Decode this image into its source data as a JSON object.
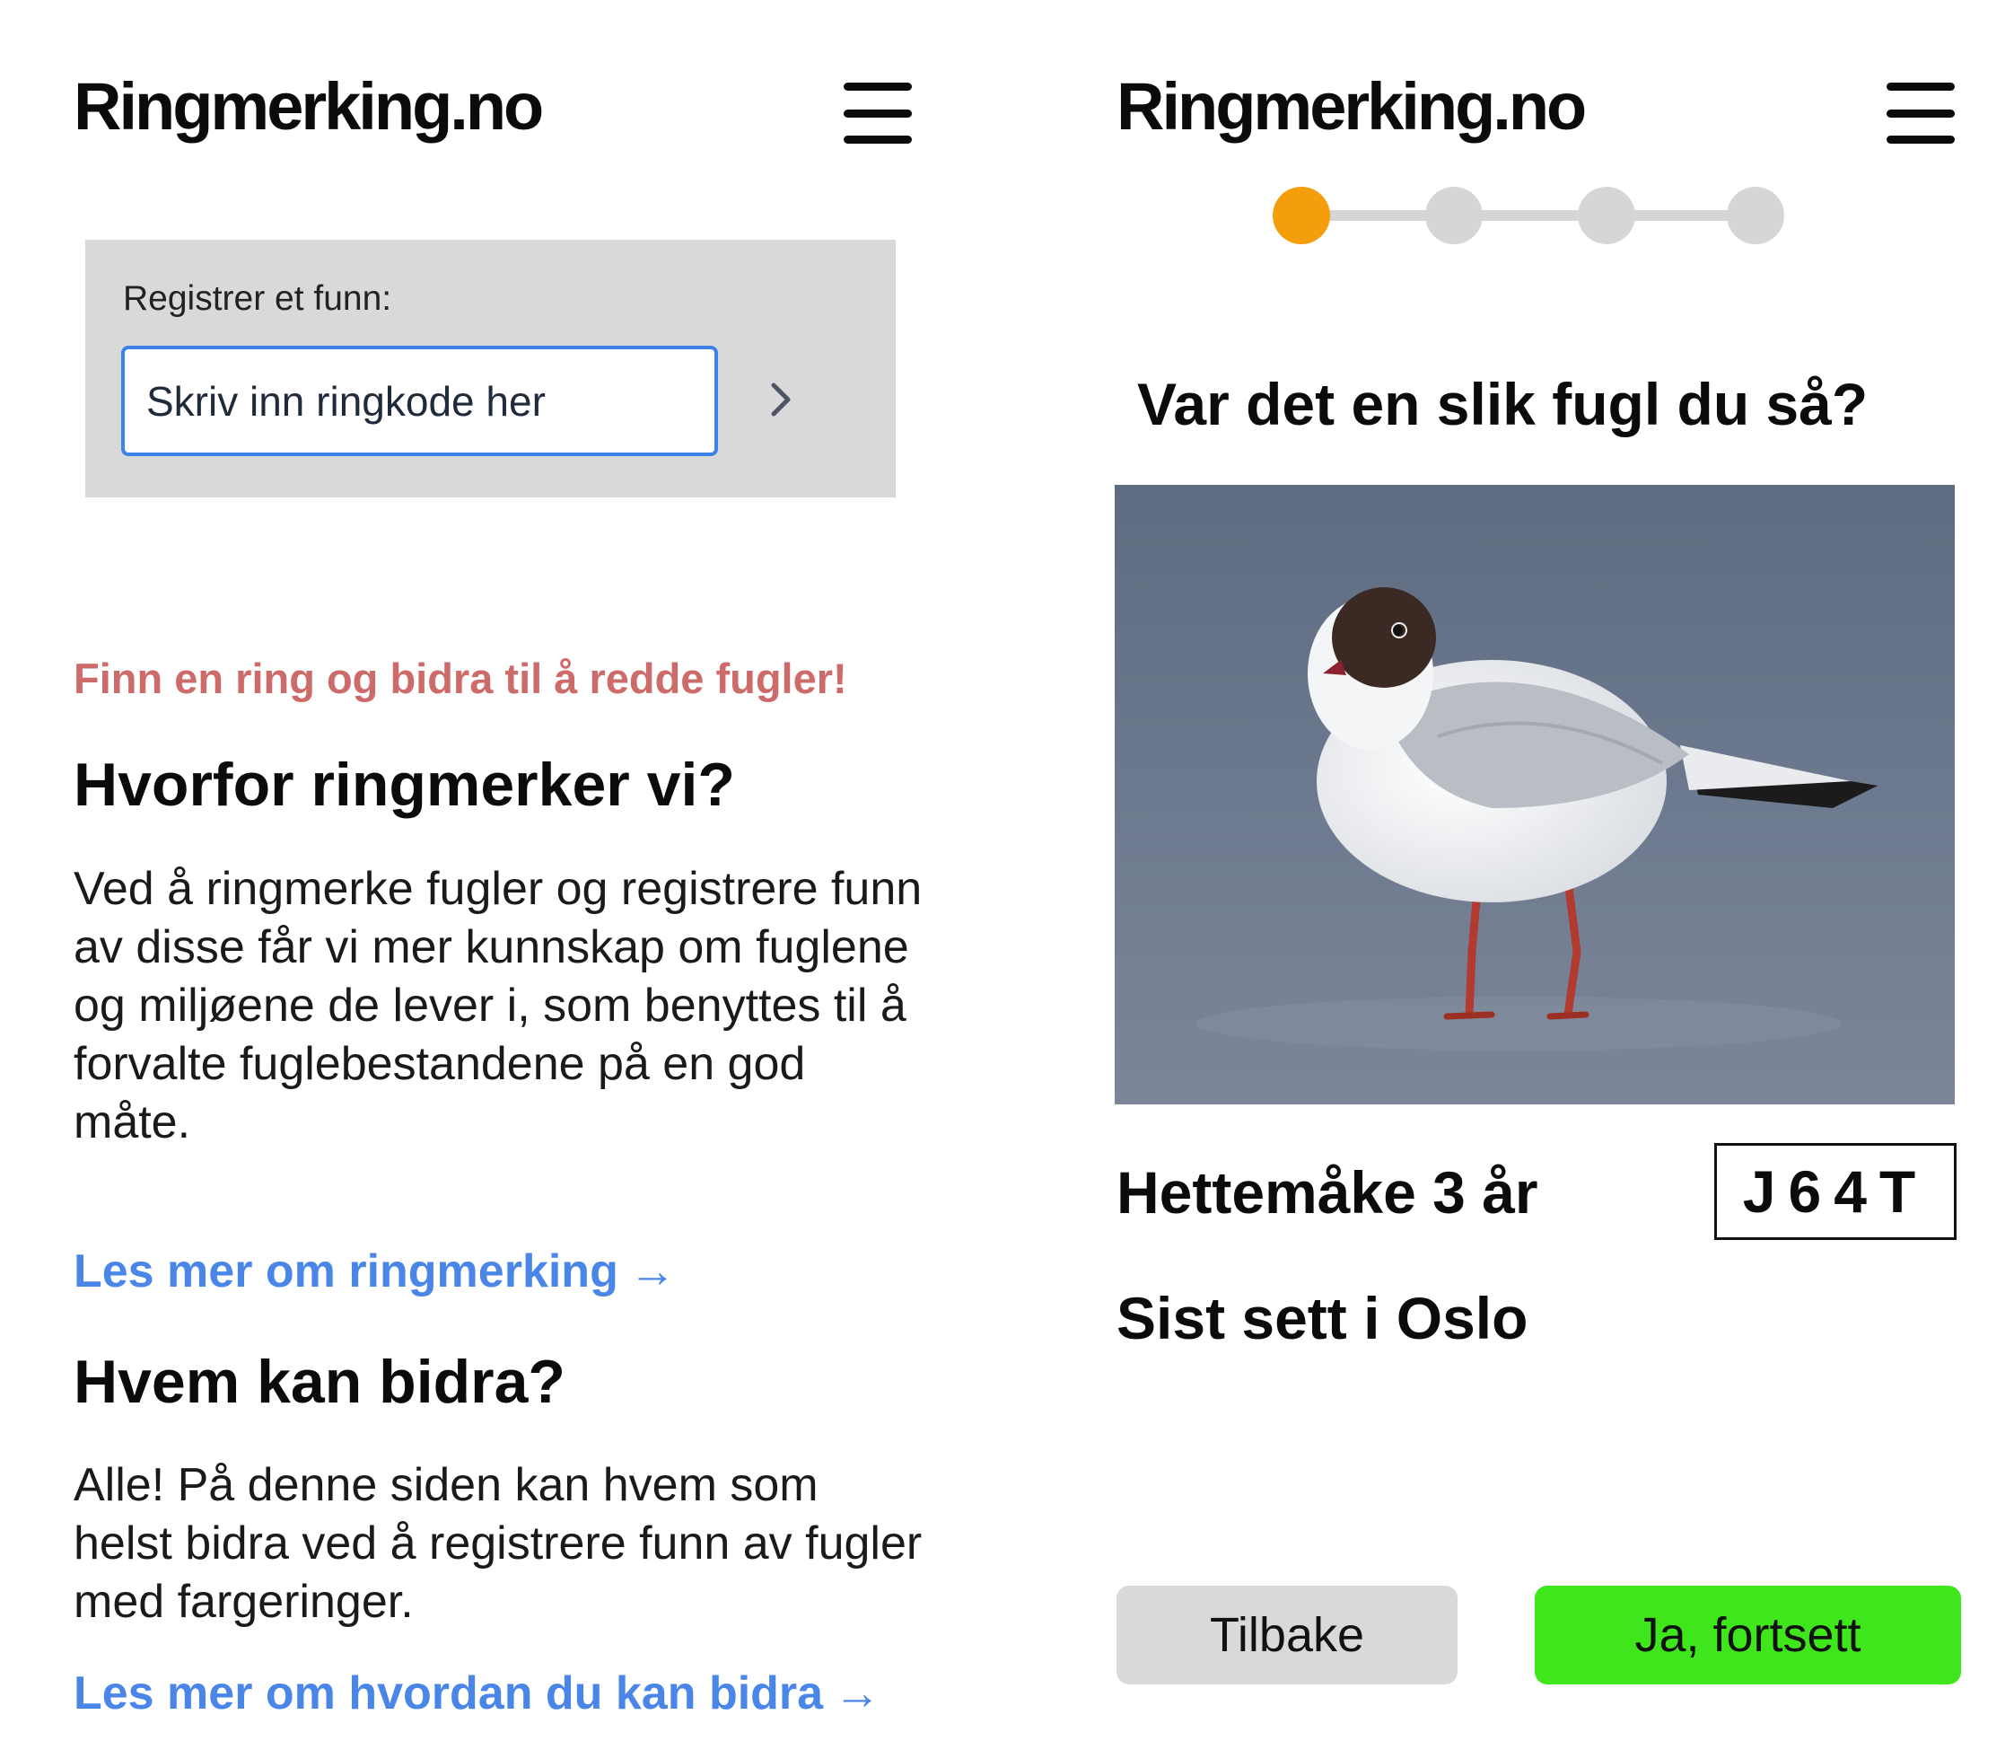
{
  "app": {
    "logo": "Ringmerking.no"
  },
  "left": {
    "register": {
      "label": "Registrer et funn:",
      "input_value": "Skriv inn ringkode her"
    },
    "tagline": "Finn en ring og bidra til å redde fugler!",
    "why": {
      "heading": "Hvorfor ringmerker vi?",
      "body": "Ved å ringmerke fugler og registrere funn av disse får vi mer kunnskap om fuglene og miljøene de lever i, som benyttes til å forvalte fuglebestandene på en god måte.",
      "link": "Les mer om ringmerking"
    },
    "who": {
      "heading": "Hvem kan bidra?",
      "body": "Alle! På denne siden kan hvem som helst bidra ved å registrere funn av fugler med fargeringer.",
      "link": "Les mer om hvordan du kan bidra"
    }
  },
  "right": {
    "stepper": {
      "total_steps": 4,
      "current_step": 1
    },
    "question": "Var det en slik fugl du så?",
    "bird": {
      "species_age": "Hettemåke 3 år",
      "ring_code": "J64T",
      "last_seen": "Sist sett i Oslo"
    },
    "buttons": {
      "back": "Tilbake",
      "next": "Ja, fortsett"
    }
  },
  "colors": {
    "accent_blue": "#4a86e8",
    "tagline_red": "#cd6b6b",
    "step_active": "#f59e0b",
    "step_inactive": "#d6d6d6",
    "continue_green": "#3fe61b",
    "panel_gray": "#d9d9d9"
  },
  "icons": [
    "menu-icon",
    "chevron-right-icon",
    "arrow-right-icon"
  ]
}
